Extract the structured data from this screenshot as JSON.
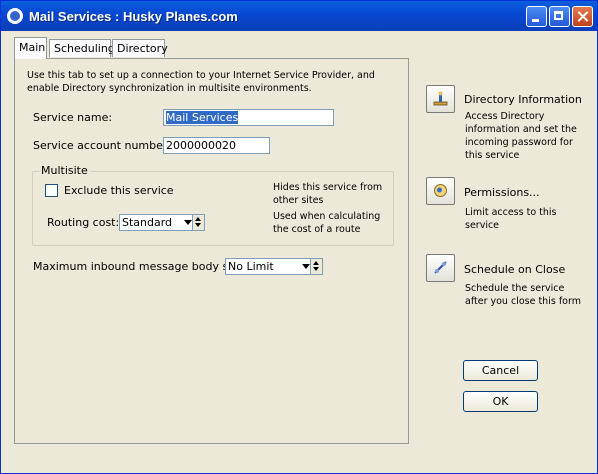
{
  "window": {
    "title": "Mail Services : Husky Planes.com"
  },
  "tabs": [
    {
      "label": "Main"
    },
    {
      "label": "Scheduling"
    },
    {
      "label": "Directory"
    }
  ],
  "main": {
    "intro": "Use this tab to set up a connection to your Internet Service Provider, and enable Directory synchronization in multisite environments.",
    "service_name_label": "Service name:",
    "service_name_value": "Mail Services",
    "account_label": "Service account number:",
    "account_value": "2000000020",
    "multisite": {
      "title": "Multisite",
      "exclude_label": "Exclude this service",
      "exclude_hint": "Hides this service from other sites",
      "routing_label": "Routing cost:",
      "routing_value": "Standard",
      "routing_hint": "Used when calculating the cost of a route"
    },
    "max_size_label": "Maximum inbound message body size:",
    "max_size_value": "No Limit"
  },
  "side": {
    "directory_title": "Directory Information",
    "directory_desc": "Access Directory information and set the incoming password for this service",
    "permissions_title": "Permissions...",
    "permissions_desc": "Limit access to this service",
    "schedule_title": "Schedule on Close",
    "schedule_desc": "Schedule the  service after you close this form"
  },
  "buttons": {
    "cancel": "Cancel",
    "ok": "OK"
  }
}
